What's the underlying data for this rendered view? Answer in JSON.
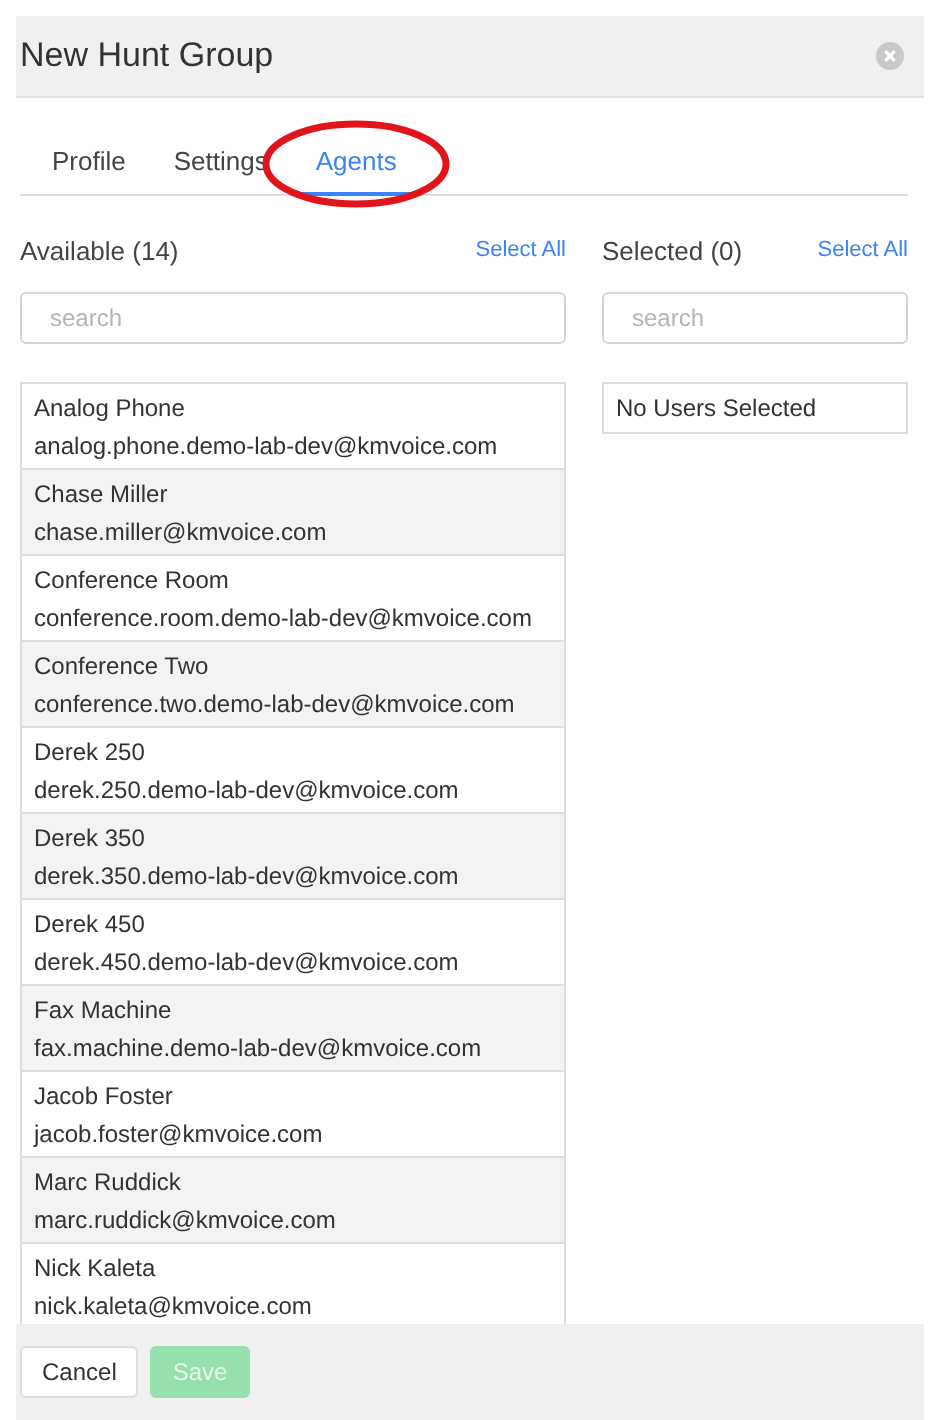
{
  "window": {
    "title": "New Hunt Group"
  },
  "tabs": [
    {
      "label": "Profile",
      "selected": false,
      "circled": false
    },
    {
      "label": "Settings",
      "selected": false,
      "circled": false
    },
    {
      "label": "Agents",
      "selected": true,
      "circled": true
    }
  ],
  "available": {
    "heading": "Available (14)",
    "select_all": "Select All",
    "search": {
      "placeholder": "search"
    },
    "users": [
      {
        "name": "Analog Phone",
        "email": "analog.phone.demo-lab-dev@kmvoice.com"
      },
      {
        "name": "Chase Miller",
        "email": "chase.miller@kmvoice.com"
      },
      {
        "name": "Conference Room",
        "email": "conference.room.demo-lab-dev@kmvoice.com"
      },
      {
        "name": "Conference Two",
        "email": "conference.two.demo-lab-dev@kmvoice.com"
      },
      {
        "name": "Derek 250",
        "email": "derek.250.demo-lab-dev@kmvoice.com"
      },
      {
        "name": "Derek 350",
        "email": "derek.350.demo-lab-dev@kmvoice.com"
      },
      {
        "name": "Derek 450",
        "email": "derek.450.demo-lab-dev@kmvoice.com"
      },
      {
        "name": "Fax Machine",
        "email": "fax.machine.demo-lab-dev@kmvoice.com"
      },
      {
        "name": "Jacob Foster",
        "email": "jacob.foster@kmvoice.com"
      },
      {
        "name": "Marc Ruddick",
        "email": "marc.ruddick@kmvoice.com"
      },
      {
        "name": "Nick Kaleta",
        "email": "nick.kaleta@kmvoice.com"
      }
    ]
  },
  "selected": {
    "heading": "Selected (0)",
    "select_all": "Select All",
    "search": {
      "placeholder": "search"
    },
    "empty": "No Users Selected"
  },
  "buttons": [
    {
      "label": "Cancel",
      "kind": "default",
      "disabled": false
    },
    {
      "label": "Save",
      "kind": "primary",
      "disabled": true
    }
  ]
}
